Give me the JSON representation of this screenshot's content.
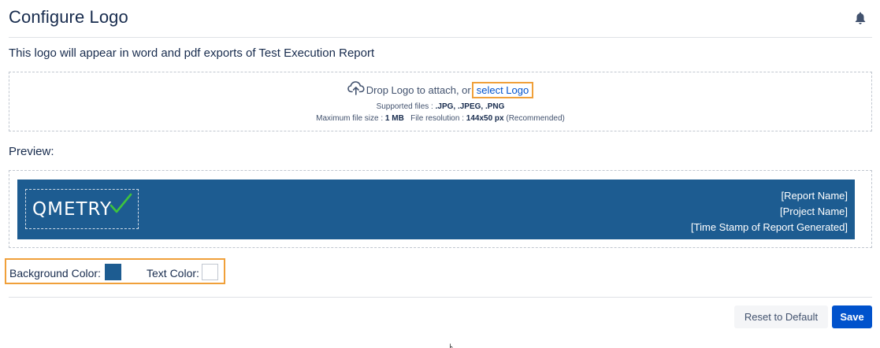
{
  "header": {
    "title": "Configure Logo",
    "notification_icon": "bell-icon"
  },
  "subtitle": "This logo will appear in word and pdf exports of Test Execution Report",
  "dropzone": {
    "icon": "cloud-upload-icon",
    "drop_text": "Drop Logo to attach, or",
    "select_link": "select Logo",
    "supported_label": "Supported files :",
    "supported_value": ".JPG, .JPEG, .PNG",
    "max_size_label": "Maximum file size :",
    "max_size_value": "1 MB",
    "resolution_label": "File resolution :",
    "resolution_value": "144x50 px",
    "resolution_note": "(Recommended)"
  },
  "preview": {
    "label": "Preview:",
    "logo_text": "QMETRY",
    "logo_check_icon": "checkmark-icon",
    "report_name": "[Report Name]",
    "project_name": "[Project Name]",
    "timestamp": "[Time Stamp of Report Generated]"
  },
  "colors_setting": {
    "background_label": "Background Color:",
    "background_value": "#1d5c91",
    "text_label": "Text Color:",
    "text_value": "#ffffff"
  },
  "actions": {
    "reset_label": "Reset to Default",
    "save_label": "Save"
  },
  "theme": {
    "accent": "#0052cc",
    "highlight": "#f0a03a",
    "banner": "#1d5c91",
    "check": "#3ec43e"
  }
}
